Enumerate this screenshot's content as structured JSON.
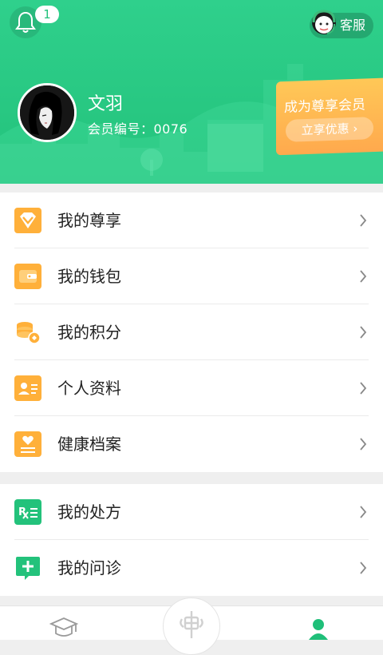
{
  "header": {
    "notification_count": "1",
    "customer_service_label": "客服",
    "user_name": "文羽",
    "member_number": "会员编号：0076",
    "vip_title": "成为尊享会员",
    "vip_button": "立享优惠",
    "vip_button_chevron": "›"
  },
  "menu_section_1": [
    {
      "label": "我的尊享",
      "icon": "diamond-icon"
    },
    {
      "label": "我的钱包",
      "icon": "wallet-icon"
    },
    {
      "label": "我的积分",
      "icon": "points-icon"
    },
    {
      "label": "个人资料",
      "icon": "profile-card-icon"
    },
    {
      "label": "健康档案",
      "icon": "health-record-icon"
    }
  ],
  "menu_section_2": [
    {
      "label": "我的处方",
      "icon": "prescription-icon"
    },
    {
      "label": "我的问诊",
      "icon": "consultation-icon"
    }
  ],
  "tabbar": {
    "tabs": [
      "graduation-cap-icon",
      "center-logo-icon",
      "user-icon"
    ]
  },
  "colors": {
    "brand_green": "#23c27b",
    "accent_orange": "#ffab4c",
    "tab_active": "#1fbf79"
  }
}
